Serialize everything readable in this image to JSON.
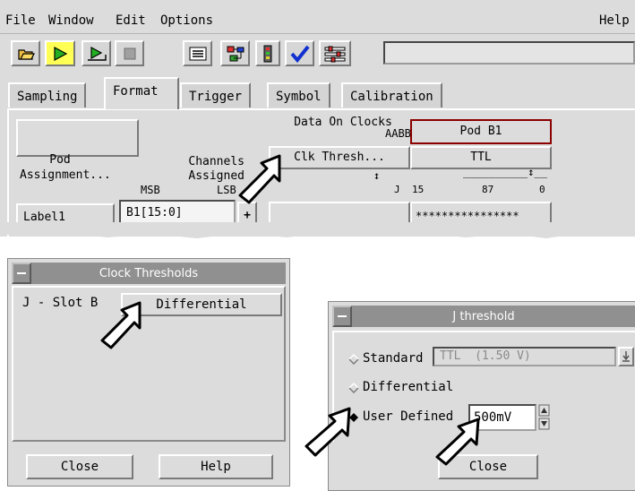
{
  "menu": {
    "file": "File",
    "window": "Window",
    "edit": "Edit",
    "options": "Options",
    "help": "Help"
  },
  "toolbar": {
    "buttons": [
      "open-icon",
      "run-icon",
      "run-repetitive-icon",
      "stop-icon",
      "listing-icon",
      "config-icon",
      "system-icon",
      "check-icon",
      "settings-icon"
    ],
    "command_field": ""
  },
  "tabs": [
    "Sampling",
    "Format",
    "Trigger",
    "Symbol",
    "Calibration"
  ],
  "active_tab": "Format",
  "format": {
    "pod_assignment": "Pod\nAssignment...",
    "channels_assigned": "Channels\nAssigned",
    "msb": "MSB",
    "lsb": "LSB",
    "data_on_clocks": "Data On Clocks",
    "clock_letters": "AABB",
    "clk_thresh_button": "Clk Thresh...",
    "pod_name": "Pod B1",
    "threshold": "TTL",
    "clock_arrow": "↕",
    "clock_j": "J",
    "bit_scale_top": "__________↕__",
    "bit_15": "15",
    "bit_87": "87",
    "bit_0": "0",
    "label_name": "Label1",
    "label_channels": "B1[15:0]",
    "plus": "+",
    "pod_mask": "****************"
  },
  "clock_dialog": {
    "title": "Clock Thresholds",
    "slot_label": "J - Slot B",
    "setting": "Differential",
    "close": "Close",
    "help": "Help"
  },
  "j_dialog": {
    "title": "J threshold",
    "standard_label": "Standard",
    "standard_value": "TTL  (1.50 V)",
    "differential_label": "Differential",
    "user_defined_label": "User Defined",
    "user_defined_value": "500mV",
    "selected_option": "User Defined",
    "close": "Close"
  },
  "colors": {
    "run_green": "#22b022",
    "selected_yellow": "#ffff55",
    "check_blue": "#1030d0",
    "pod_border": "#8b0000"
  }
}
